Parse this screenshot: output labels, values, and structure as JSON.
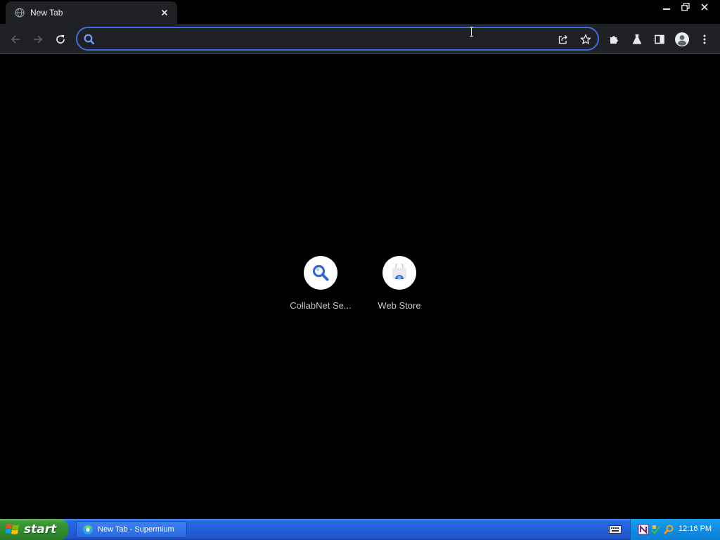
{
  "browser": {
    "tab": {
      "title": "New Tab",
      "favicon": "globe-icon",
      "close": "close-icon"
    },
    "window_controls": [
      "minimize-icon",
      "restore-icon",
      "close-icon"
    ],
    "toolbar": {
      "back": "arrow-left-icon",
      "forward": "arrow-right-icon",
      "reload": "reload-icon",
      "omnibox": {
        "value": "",
        "placeholder": "",
        "icon": "search-icon",
        "focus_color": "#3b6fe0"
      },
      "omnibox_actions": [
        "share-icon",
        "star-icon"
      ],
      "extensions": "puzzle-icon",
      "labs": "flask-icon",
      "side_panel": "side-panel-icon",
      "profile": "avatar-icon",
      "menu": "kebab-menu-icon"
    }
  },
  "ntp": {
    "shortcuts": [
      {
        "label": "CollabNet Se...",
        "icon": "magnifier-icon"
      },
      {
        "label": "Web Store",
        "icon": "web-store-icon"
      }
    ]
  },
  "taskbar": {
    "start_label": "start",
    "tasks": [
      {
        "label": "New Tab - Supermium",
        "icon": "supermium-icon"
      }
    ],
    "tray": {
      "icons": [
        "onenote-icon",
        "network-icon",
        "search-icon"
      ],
      "clock": "12:16 PM"
    },
    "colors": {
      "bar": "#245edb",
      "start": "#3c9a38",
      "tray": "#0f8ce4"
    }
  }
}
